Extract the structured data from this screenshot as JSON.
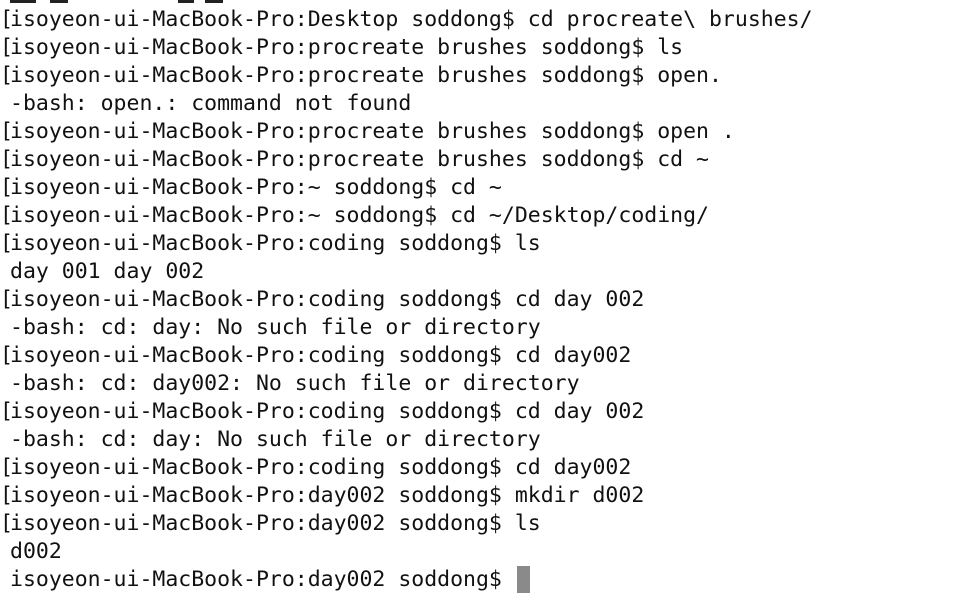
{
  "terminal": {
    "lines": [
      {
        "bracket": true,
        "text": "isoyeon-ui-MacBook-Pro:Desktop soddong$ cd procreate\\ brushes/"
      },
      {
        "bracket": true,
        "text": "isoyeon-ui-MacBook-Pro:procreate brushes soddong$ ls"
      },
      {
        "bracket": true,
        "text": "isoyeon-ui-MacBook-Pro:procreate brushes soddong$ open."
      },
      {
        "bracket": false,
        "text": "-bash: open.: command not found"
      },
      {
        "bracket": true,
        "text": "isoyeon-ui-MacBook-Pro:procreate brushes soddong$ open ."
      },
      {
        "bracket": true,
        "text": "isoyeon-ui-MacBook-Pro:procreate brushes soddong$ cd ~"
      },
      {
        "bracket": true,
        "text": "isoyeon-ui-MacBook-Pro:~ soddong$ cd ~"
      },
      {
        "bracket": true,
        "text": "isoyeon-ui-MacBook-Pro:~ soddong$ cd ~/Desktop/coding/"
      },
      {
        "bracket": true,
        "text": "isoyeon-ui-MacBook-Pro:coding soddong$ ls"
      },
      {
        "bracket": false,
        "text": "day 001 day 002"
      },
      {
        "bracket": true,
        "text": "isoyeon-ui-MacBook-Pro:coding soddong$ cd day 002"
      },
      {
        "bracket": false,
        "text": "-bash: cd: day: No such file or directory"
      },
      {
        "bracket": true,
        "text": "isoyeon-ui-MacBook-Pro:coding soddong$ cd day002"
      },
      {
        "bracket": false,
        "text": "-bash: cd: day002: No such file or directory"
      },
      {
        "bracket": true,
        "text": "isoyeon-ui-MacBook-Pro:coding soddong$ cd day 002"
      },
      {
        "bracket": false,
        "text": "-bash: cd: day: No such file or directory"
      },
      {
        "bracket": true,
        "text": "isoyeon-ui-MacBook-Pro:coding soddong$ cd day002"
      },
      {
        "bracket": true,
        "text": "isoyeon-ui-MacBook-Pro:day002 soddong$ mkdir d002"
      },
      {
        "bracket": true,
        "text": "isoyeon-ui-MacBook-Pro:day002 soddong$ ls"
      },
      {
        "bracket": false,
        "text": "d002"
      },
      {
        "bracket": false,
        "text": "isoyeon-ui-MacBook-Pro:day002 soddong$ ",
        "cursor": true
      }
    ],
    "bracket_char": "["
  }
}
